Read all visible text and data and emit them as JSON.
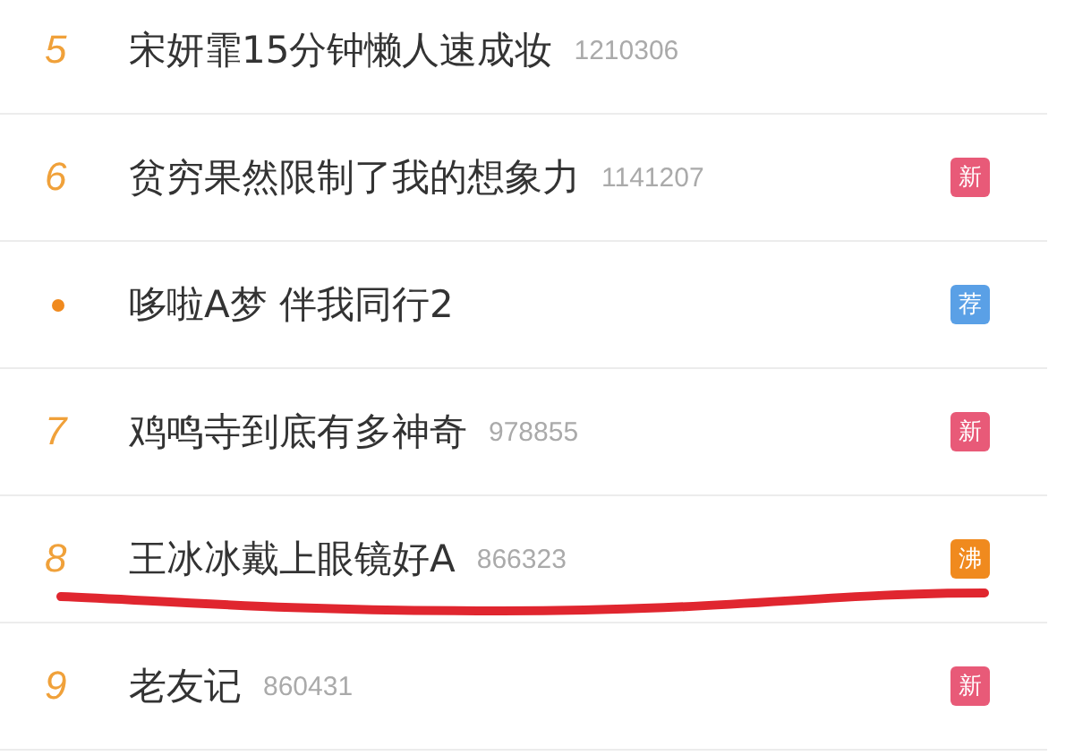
{
  "hot_list": [
    {
      "kind": "rank",
      "rank": "5",
      "title": "宋妍霏15分钟懒人速成妆",
      "count": "1210306",
      "highlighted": false
    },
    {
      "kind": "rank",
      "rank": "6",
      "title": "贫穷果然限制了我的想象力",
      "count": "1141207",
      "badge": {
        "text": "新",
        "color": "#e85a78"
      },
      "highlighted": false
    },
    {
      "kind": "promoted",
      "title": "哆啦A梦 伴我同行2",
      "badge": {
        "text": "荐",
        "color": "#5aa0e6"
      },
      "highlighted": false
    },
    {
      "kind": "rank",
      "rank": "7",
      "title": "鸡鸣寺到底有多神奇",
      "count": "978855",
      "badge": {
        "text": "新",
        "color": "#e85a78"
      },
      "highlighted": false
    },
    {
      "kind": "rank",
      "rank": "8",
      "title": "王冰冰戴上眼镜好A",
      "count": "866323",
      "badge": {
        "text": "沸",
        "color": "#f08a1e"
      },
      "highlighted": true
    },
    {
      "kind": "rank",
      "rank": "9",
      "title": "老友记",
      "count": "860431",
      "badge": {
        "text": "新",
        "color": "#e85a78"
      },
      "highlighted": false
    }
  ]
}
